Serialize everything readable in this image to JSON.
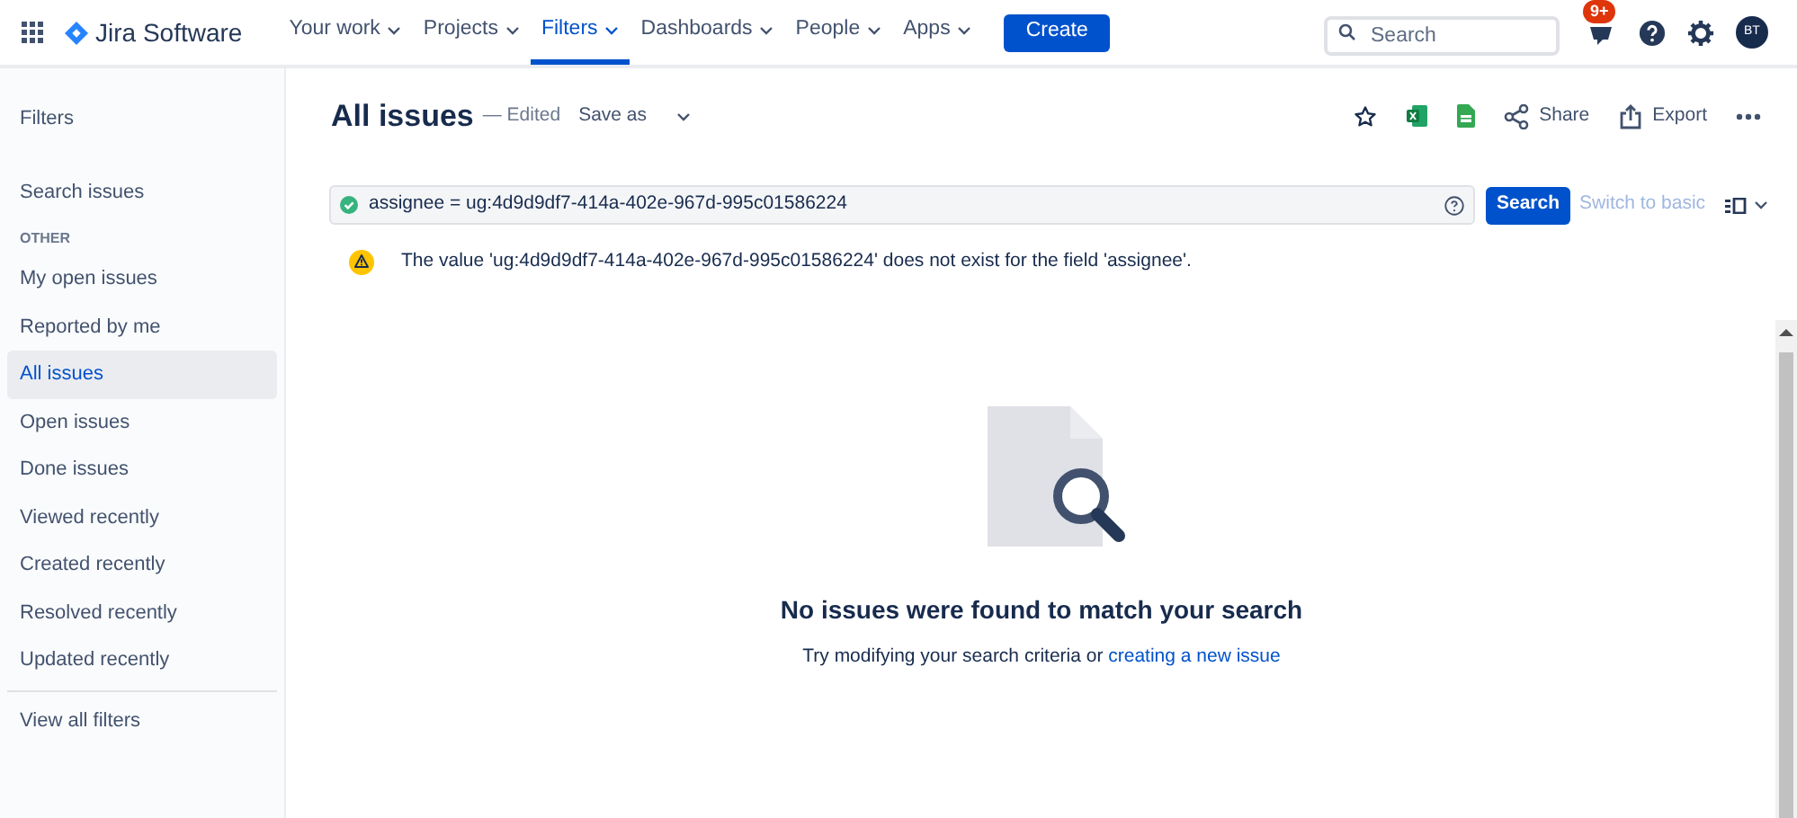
{
  "nav": {
    "app_name": "Jira Software",
    "items": [
      {
        "label": "Your work",
        "selected": false
      },
      {
        "label": "Projects",
        "selected": false
      },
      {
        "label": "Filters",
        "selected": true
      },
      {
        "label": "Dashboards",
        "selected": false
      },
      {
        "label": "People",
        "selected": false
      },
      {
        "label": "Apps",
        "selected": false
      }
    ],
    "create_label": "Create",
    "search": {
      "placeholder": "Search"
    },
    "notification_badge": "9+",
    "avatar_initials": "BT"
  },
  "sidebar": {
    "title": "Filters",
    "search_link": "Search issues",
    "section_heading": "OTHER",
    "items": [
      {
        "label": "My open issues",
        "selected": false
      },
      {
        "label": "Reported by me",
        "selected": false
      },
      {
        "label": "All issues",
        "selected": true
      },
      {
        "label": "Open issues",
        "selected": false
      },
      {
        "label": "Done issues",
        "selected": false
      },
      {
        "label": "Viewed recently",
        "selected": false
      },
      {
        "label": "Created recently",
        "selected": false
      },
      {
        "label": "Resolved recently",
        "selected": false
      },
      {
        "label": "Updated recently",
        "selected": false
      }
    ],
    "footer_link": "View all filters"
  },
  "header": {
    "title": "All issues",
    "status": "— Edited",
    "save_as": "Save as",
    "actions": [
      {
        "kind": "star"
      },
      {
        "kind": "excel"
      },
      {
        "kind": "sheets"
      },
      {
        "kind": "share",
        "label": "Share"
      },
      {
        "kind": "export",
        "label": "Export"
      },
      {
        "kind": "more"
      }
    ]
  },
  "query": {
    "value": "assignee = ug:4d9d9df7-414a-402e-967d-995c01586224",
    "valid": true,
    "search_button": "Search",
    "switch_link": {
      "label": "Switch to basic",
      "disabled": true
    }
  },
  "view_menu": {
    "expanded": false
  },
  "warning": "The value 'ug:4d9d9df7-414a-402e-967d-995c01586224' does not exist for the field 'assignee'.",
  "empty_state": {
    "title": "No issues were found to match your search",
    "text": "Try modifying your search criteria or",
    "link": "creating a new issue"
  }
}
